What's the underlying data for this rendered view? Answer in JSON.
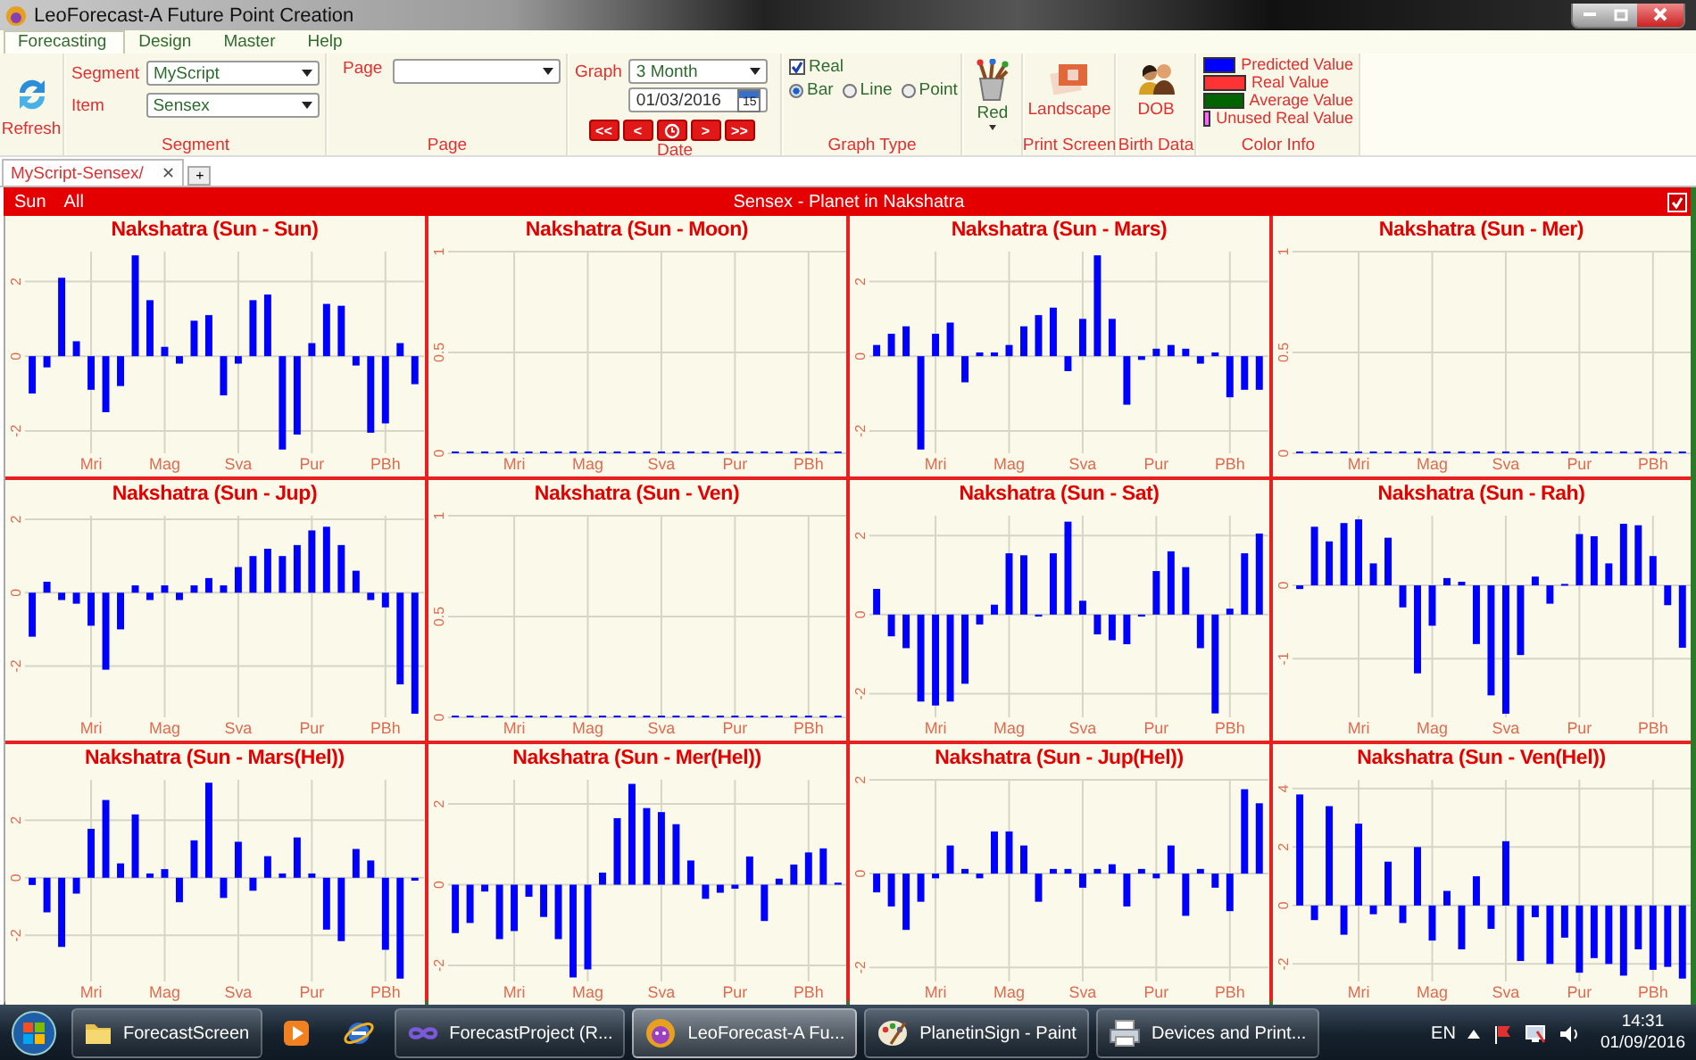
{
  "window": {
    "title": "LeoForecast-A Future Point Creation"
  },
  "menu_tabs": [
    {
      "label": "Forecasting",
      "selected": true
    },
    {
      "label": "Design",
      "selected": false
    },
    {
      "label": "Master",
      "selected": false
    },
    {
      "label": "Help",
      "selected": false
    }
  ],
  "ribbon": {
    "refresh": {
      "label": "Refresh"
    },
    "segment_group": {
      "caption": "Segment",
      "segment": {
        "label": "Segment",
        "value": "MyScript"
      },
      "item": {
        "label": "Item",
        "value": "Sensex"
      }
    },
    "page_group": {
      "caption": "Page",
      "page": {
        "label": "Page"
      }
    },
    "date_group": {
      "caption": "Date",
      "graph": {
        "label": "Graph",
        "value": "3 Month"
      },
      "date": {
        "value": "01/03/2016",
        "calendar_day": "15"
      },
      "nav_buttons": [
        {
          "kind": "text",
          "label": "<<"
        },
        {
          "kind": "text",
          "label": "<"
        },
        {
          "kind": "clock"
        },
        {
          "kind": "text",
          "label": ">"
        },
        {
          "kind": "text",
          "label": ">>"
        }
      ]
    },
    "graph_type": {
      "caption": "Graph Type",
      "real": {
        "label": "Real",
        "checked": true
      },
      "options": [
        {
          "label": "Bar",
          "selected": true
        },
        {
          "label": "Line",
          "selected": false
        },
        {
          "label": "Point",
          "selected": false
        }
      ]
    },
    "color_button": {
      "label": "Red"
    },
    "print_screen": {
      "caption": "Print Screen",
      "button": "Landscape"
    },
    "birth_data": {
      "caption": "Birth Data",
      "button": "DOB"
    },
    "color_info": {
      "caption": "Color Info",
      "items": [
        {
          "label": "Predicted Value",
          "color": "#0000ff"
        },
        {
          "label": "Real Value",
          "color": "#ff3333"
        },
        {
          "label": "Average Value",
          "color": "#006400"
        },
        {
          "label": "Unused Real Value",
          "color": "#ff66ff"
        }
      ]
    }
  },
  "doc_tabs": [
    {
      "label": "MyScript-Sensex/",
      "selected": true,
      "close": "✕"
    }
  ],
  "add_tab": "+",
  "header": {
    "links": [
      "Sun",
      "All"
    ],
    "title": "Sensex - Planet in Nakshatra",
    "checked": true
  },
  "charts": [
    {
      "chart_data": {
        "type": "bar",
        "title": "Nakshatra (Sun - Sun)",
        "grid": true,
        "ylim": [
          -2.6,
          2.8
        ],
        "yticks": [
          -2,
          0,
          2
        ],
        "categories": [
          null,
          null,
          null,
          null,
          "Mri",
          null,
          null,
          null,
          null,
          "Mag",
          null,
          null,
          null,
          null,
          "Sva",
          null,
          null,
          null,
          null,
          "Pur",
          null,
          null,
          null,
          null,
          "PBh",
          null,
          null
        ],
        "values": [
          -1.0,
          -0.3,
          2.1,
          0.4,
          -0.9,
          -1.5,
          -0.8,
          2.7,
          1.5,
          0.25,
          -0.2,
          0.95,
          1.1,
          -1.05,
          -0.2,
          1.5,
          1.65,
          -2.5,
          -2.1,
          0.35,
          1.4,
          1.35,
          -0.25,
          -2.05,
          -1.8,
          0.35,
          -0.75
        ]
      }
    },
    {
      "chart_data": {
        "type": "bar",
        "title": "Nakshatra (Sun - Moon)",
        "grid": true,
        "ylim": [
          0,
          1
        ],
        "yticks": [
          0,
          0.5,
          1
        ],
        "categories": [
          null,
          null,
          null,
          null,
          "Mri",
          null,
          null,
          null,
          null,
          "Mag",
          null,
          null,
          null,
          null,
          "Sva",
          null,
          null,
          null,
          null,
          "Pur",
          null,
          null,
          null,
          null,
          "PBh",
          null,
          null
        ],
        "values": [
          0,
          0,
          0,
          0,
          0,
          0,
          0,
          0,
          0,
          0,
          0,
          0,
          0,
          0,
          0,
          0,
          0,
          0,
          0,
          0,
          0,
          0,
          0,
          0,
          0,
          0,
          0
        ]
      }
    },
    {
      "chart_data": {
        "type": "bar",
        "title": "Nakshatra (Sun - Mars)",
        "grid": true,
        "ylim": [
          -2.6,
          2.8
        ],
        "yticks": [
          -2,
          0,
          2
        ],
        "categories": [
          null,
          null,
          null,
          null,
          "Mri",
          null,
          null,
          null,
          null,
          "Mag",
          null,
          null,
          null,
          null,
          "Sva",
          null,
          null,
          null,
          null,
          "Pur",
          null,
          null,
          null,
          null,
          "PBh",
          null,
          null
        ],
        "values": [
          0.3,
          0.6,
          0.8,
          -2.5,
          0.6,
          0.9,
          -0.7,
          0.1,
          0.1,
          0.3,
          0.8,
          1.1,
          1.3,
          -0.4,
          1.0,
          2.7,
          1.0,
          -1.3,
          -0.1,
          0.2,
          0.3,
          0.2,
          -0.2,
          0.1,
          -1.1,
          -0.9,
          -0.9
        ]
      }
    },
    {
      "chart_data": {
        "type": "bar",
        "title": "Nakshatra (Sun - Mer)",
        "grid": true,
        "ylim": [
          0,
          1
        ],
        "yticks": [
          0,
          0.5,
          1
        ],
        "categories": [
          null,
          null,
          null,
          null,
          "Mri",
          null,
          null,
          null,
          null,
          "Mag",
          null,
          null,
          null,
          null,
          "Sva",
          null,
          null,
          null,
          null,
          "Pur",
          null,
          null,
          null,
          null,
          "PBh",
          null,
          null
        ],
        "values": [
          0,
          0,
          0,
          0,
          0,
          0,
          0,
          0,
          0,
          0,
          0,
          0,
          0,
          0,
          0,
          0,
          0,
          0,
          0,
          0,
          0,
          0,
          0,
          0,
          0,
          0,
          0
        ]
      }
    },
    {
      "chart_data": {
        "type": "bar",
        "title": "Nakshatra (Sun - Jup)",
        "grid": true,
        "ylim": [
          -3.4,
          2.1
        ],
        "yticks": [
          -2,
          0,
          2
        ],
        "categories": [
          null,
          null,
          null,
          null,
          "Mri",
          null,
          null,
          null,
          null,
          "Mag",
          null,
          null,
          null,
          null,
          "Sva",
          null,
          null,
          null,
          null,
          "Pur",
          null,
          null,
          null,
          null,
          "PBh",
          null,
          null
        ],
        "values": [
          -1.2,
          0.3,
          -0.2,
          -0.3,
          -0.9,
          -2.1,
          -1.0,
          0.2,
          -0.2,
          0.2,
          -0.2,
          0.2,
          0.4,
          0.2,
          0.7,
          1.0,
          1.2,
          1.0,
          1.3,
          1.7,
          1.8,
          1.3,
          0.6,
          -0.2,
          -0.4,
          -2.5,
          -3.3
        ]
      }
    },
    {
      "chart_data": {
        "type": "bar",
        "title": "Nakshatra (Sun - Ven)",
        "grid": true,
        "ylim": [
          0,
          1
        ],
        "yticks": [
          0,
          0.5,
          1
        ],
        "categories": [
          null,
          null,
          null,
          null,
          "Mri",
          null,
          null,
          null,
          null,
          "Mag",
          null,
          null,
          null,
          null,
          "Sva",
          null,
          null,
          null,
          null,
          "Pur",
          null,
          null,
          null,
          null,
          "PBh",
          null,
          null
        ],
        "values": [
          0,
          0,
          0,
          0,
          0,
          0,
          0,
          0,
          0,
          0,
          0,
          0,
          0,
          0,
          0,
          0,
          0,
          0,
          0,
          0,
          0,
          0,
          0,
          0,
          0,
          0,
          0
        ]
      }
    },
    {
      "chart_data": {
        "type": "bar",
        "title": "Nakshatra (Sun - Sat)",
        "grid": true,
        "ylim": [
          -2.6,
          2.5
        ],
        "yticks": [
          -2,
          0,
          2
        ],
        "categories": [
          null,
          null,
          null,
          null,
          "Mri",
          null,
          null,
          null,
          null,
          "Mag",
          null,
          null,
          null,
          null,
          "Sva",
          null,
          null,
          null,
          null,
          "Pur",
          null,
          null,
          null,
          null,
          "PBh",
          null,
          null
        ],
        "values": [
          0.65,
          -0.55,
          -0.85,
          -2.2,
          -2.3,
          -2.2,
          -1.75,
          -0.25,
          0.25,
          1.55,
          1.5,
          -0.05,
          1.55,
          2.35,
          0.35,
          -0.5,
          -0.65,
          -0.75,
          -0.05,
          1.1,
          1.6,
          1.2,
          -0.85,
          -2.5,
          0.15,
          1.55,
          2.05
        ]
      }
    },
    {
      "chart_data": {
        "type": "bar",
        "title": "Nakshatra (Sun - Rah)",
        "grid": true,
        "ylim": [
          -1.8,
          0.95
        ],
        "yticks": [
          -1,
          0
        ],
        "categories": [
          null,
          null,
          null,
          null,
          "Mri",
          null,
          null,
          null,
          null,
          "Mag",
          null,
          null,
          null,
          null,
          "Sva",
          null,
          null,
          null,
          null,
          "Pur",
          null,
          null,
          null,
          null,
          "PBh",
          null,
          null
        ],
        "values": [
          -0.05,
          0.8,
          0.6,
          0.85,
          0.9,
          0.3,
          0.65,
          -0.3,
          -1.2,
          -0.55,
          0.1,
          0.05,
          -0.8,
          -1.5,
          -1.75,
          -0.95,
          0.12,
          -0.25,
          0.02,
          0.7,
          0.67,
          0.3,
          0.84,
          0.82,
          0.4,
          -0.27,
          -0.85
        ]
      }
    },
    {
      "chart_data": {
        "type": "bar",
        "title": "Nakshatra (Sun - Mars(Hel))",
        "grid": true,
        "ylim": [
          -3.6,
          3.4
        ],
        "yticks": [
          -2,
          0,
          2
        ],
        "categories": [
          null,
          null,
          null,
          null,
          "Mri",
          null,
          null,
          null,
          null,
          "Mag",
          null,
          null,
          null,
          null,
          "Sva",
          null,
          null,
          null,
          null,
          "Pur",
          null,
          null,
          null,
          null,
          "PBh",
          null,
          null
        ],
        "values": [
          -0.25,
          -1.2,
          -2.4,
          -0.55,
          1.7,
          2.7,
          0.5,
          2.2,
          0.15,
          0.3,
          -0.85,
          1.3,
          3.3,
          -0.7,
          1.25,
          -0.45,
          0.75,
          0.15,
          1.4,
          0.15,
          -1.8,
          -2.2,
          1.0,
          0.6,
          -2.5,
          -3.5,
          -0.1
        ]
      }
    },
    {
      "chart_data": {
        "type": "bar",
        "title": "Nakshatra (Sun - Mer(Hel))",
        "grid": true,
        "ylim": [
          -2.4,
          2.6
        ],
        "yticks": [
          -2,
          0,
          2
        ],
        "categories": [
          null,
          null,
          null,
          null,
          "Mri",
          null,
          null,
          null,
          null,
          "Mag",
          null,
          null,
          null,
          null,
          "Sva",
          null,
          null,
          null,
          null,
          "Pur",
          null,
          null,
          null,
          null,
          "PBh",
          null,
          null
        ],
        "values": [
          -1.2,
          -0.95,
          -0.17,
          -1.35,
          -1.15,
          -0.3,
          -0.8,
          -1.35,
          -2.3,
          -2.1,
          0.3,
          1.65,
          2.5,
          1.9,
          1.8,
          1.5,
          0.6,
          -0.35,
          -0.2,
          -0.1,
          0.7,
          -0.9,
          0.15,
          0.5,
          0.8,
          0.9,
          0.05
        ]
      }
    },
    {
      "chart_data": {
        "type": "bar",
        "title": "Nakshatra (Sun - Jup(Hel))",
        "grid": true,
        "ylim": [
          -2.3,
          2.0
        ],
        "yticks": [
          -2,
          0,
          2
        ],
        "categories": [
          null,
          null,
          null,
          null,
          "Mri",
          null,
          null,
          null,
          null,
          "Mag",
          null,
          null,
          null,
          null,
          "Sva",
          null,
          null,
          null,
          null,
          "Pur",
          null,
          null,
          null,
          null,
          "PBh",
          null,
          null
        ],
        "values": [
          -0.4,
          -0.7,
          -1.2,
          -0.6,
          -0.1,
          0.6,
          0.1,
          -0.1,
          0.9,
          0.9,
          0.6,
          -0.6,
          0.1,
          0.1,
          -0.3,
          0.1,
          0.2,
          -0.7,
          0.1,
          -0.1,
          0.6,
          -0.9,
          0.1,
          -0.3,
          -0.8,
          1.8,
          1.5
        ]
      }
    },
    {
      "chart_data": {
        "type": "bar",
        "title": "Nakshatra (Sun - Ven(Hel))",
        "grid": true,
        "ylim": [
          -2.6,
          4.3
        ],
        "yticks": [
          -2,
          0,
          2,
          4
        ],
        "categories": [
          null,
          null,
          null,
          null,
          "Mri",
          null,
          null,
          null,
          null,
          "Mag",
          null,
          null,
          null,
          null,
          "Sva",
          null,
          null,
          null,
          null,
          "Pur",
          null,
          null,
          null,
          null,
          "PBh",
          null,
          null
        ],
        "values": [
          3.8,
          -0.5,
          3.4,
          -1.0,
          2.8,
          -0.3,
          1.5,
          -0.6,
          2.0,
          -1.2,
          0.5,
          -1.5,
          1.0,
          -0.8,
          2.2,
          -1.9,
          -0.4,
          -2.0,
          -1.1,
          -2.3,
          -1.8,
          -2.0,
          -2.4,
          -1.5,
          -2.2,
          -2.1,
          -2.5
        ]
      }
    }
  ],
  "taskbar": {
    "items": [
      {
        "kind": "folder",
        "label": "ForecastScreen",
        "selected": false
      },
      {
        "kind": "media",
        "selected": false
      },
      {
        "kind": "browser",
        "selected": false
      },
      {
        "kind": "infinity",
        "label": "ForecastProject (R...",
        "selected": false
      },
      {
        "kind": "lion",
        "label": "LeoForecast-A Fu...",
        "selected": true
      },
      {
        "kind": "paint",
        "label": "PlanetinSign - Paint",
        "selected": false
      },
      {
        "kind": "devices",
        "label": "Devices and Print...",
        "selected": false
      }
    ],
    "language": "EN",
    "time": "14:31",
    "date": "01/09/2016"
  }
}
